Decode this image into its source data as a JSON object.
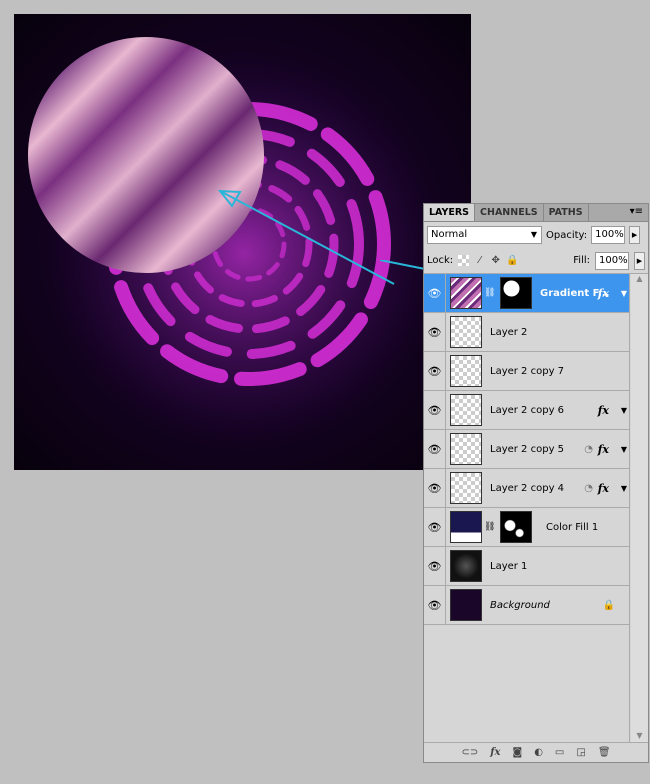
{
  "panel": {
    "tabs": [
      "LAYERS",
      "CHANNELS",
      "PATHS"
    ],
    "menu_icon": "panel-menu-icon",
    "blend_mode": "Normal",
    "opacity_label": "Opacity:",
    "opacity": "100%",
    "lock_label": "Lock:",
    "fill_label": "Fill:",
    "fill": "100%"
  },
  "layers": [
    {
      "name": "Gradient F...",
      "fx": "fx"
    },
    {
      "name": "Layer 2"
    },
    {
      "name": "Layer 2 copy 7"
    },
    {
      "name": "Layer 2 copy 6",
      "fx": "fx"
    },
    {
      "name": "Layer 2 copy 5",
      "fx": "fx"
    },
    {
      "name": "Layer 2 copy 4",
      "fx": "fx"
    },
    {
      "name": "Color Fill 1"
    },
    {
      "name": "Layer 1"
    },
    {
      "name": "Background"
    }
  ],
  "colors": {
    "selection": "#3d95ee",
    "arrow": "#29b6d8"
  }
}
